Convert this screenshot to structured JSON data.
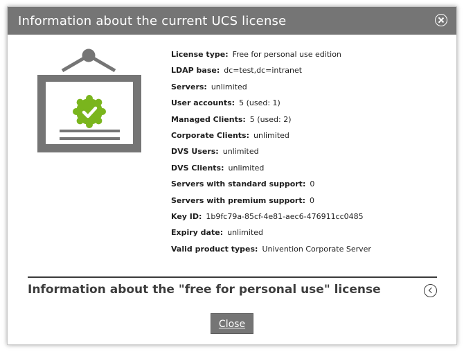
{
  "dialog": {
    "title": "Information about the current UCS license",
    "close_icon": "close-circle-icon"
  },
  "illustration": {
    "icon": "license-certificate-icon",
    "check_icon": "check-badge-icon",
    "accent": "#7ab51d"
  },
  "license": [
    {
      "key": "License type:",
      "value": "Free for personal use edition"
    },
    {
      "key": "LDAP base:",
      "value": "dc=test,dc=intranet"
    },
    {
      "key": "Servers:",
      "value": "unlimited"
    },
    {
      "key": "User accounts:",
      "value": "5 (used: 1)"
    },
    {
      "key": "Managed Clients:",
      "value": "5 (used: 2)"
    },
    {
      "key": "Corporate Clients:",
      "value": "unlimited"
    },
    {
      "key": "DVS Users:",
      "value": "unlimited"
    },
    {
      "key": "DVS Clients:",
      "value": "unlimited"
    },
    {
      "key": "Servers with standard support:",
      "value": "0"
    },
    {
      "key": "Servers with premium support:",
      "value": "0"
    },
    {
      "key": "Key ID:",
      "value": "1b9fc79a-85cf-4e81-aec6-476911cc0485"
    },
    {
      "key": "Expiry date:",
      "value": "unlimited"
    },
    {
      "key": "Valid product types:",
      "value": "Univention Corporate Server"
    }
  ],
  "section": {
    "title": "Information about the \"free for personal use\" license",
    "expand_icon": "chevron-left-circle-icon"
  },
  "footer": {
    "close_label": "Close"
  }
}
